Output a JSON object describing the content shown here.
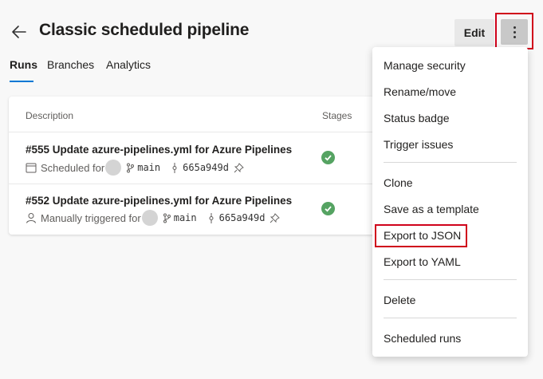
{
  "header": {
    "title": "Classic scheduled pipeline",
    "edit_label": "Edit"
  },
  "tabs": [
    {
      "label": "Runs",
      "active": true
    },
    {
      "label": "Branches",
      "active": false
    },
    {
      "label": "Analytics",
      "active": false
    }
  ],
  "table": {
    "columns": {
      "description": "Description",
      "stages": "Stages"
    },
    "rows": [
      {
        "title": "#555 Update azure-pipelines.yml for Azure Pipelines",
        "trigger": "Scheduled for",
        "trigger_icon": "calendar-icon",
        "branch": "main",
        "commit": "665a949d",
        "status": "succeeded"
      },
      {
        "title": "#552 Update azure-pipelines.yml for Azure Pipelines",
        "trigger": "Manually triggered for",
        "trigger_icon": "person-icon",
        "branch": "main",
        "commit": "665a949d",
        "status": "succeeded"
      }
    ]
  },
  "menu": {
    "items": [
      "Manage security",
      "Rename/move",
      "Status badge",
      "Trigger issues",
      "Clone",
      "Save as a template",
      "Export to JSON",
      "Export to YAML",
      "Delete",
      "Scheduled runs"
    ],
    "highlighted": "Export to JSON"
  },
  "colors": {
    "accent": "#0078d4",
    "success": "#55a362",
    "highlight": "#d0021b"
  }
}
